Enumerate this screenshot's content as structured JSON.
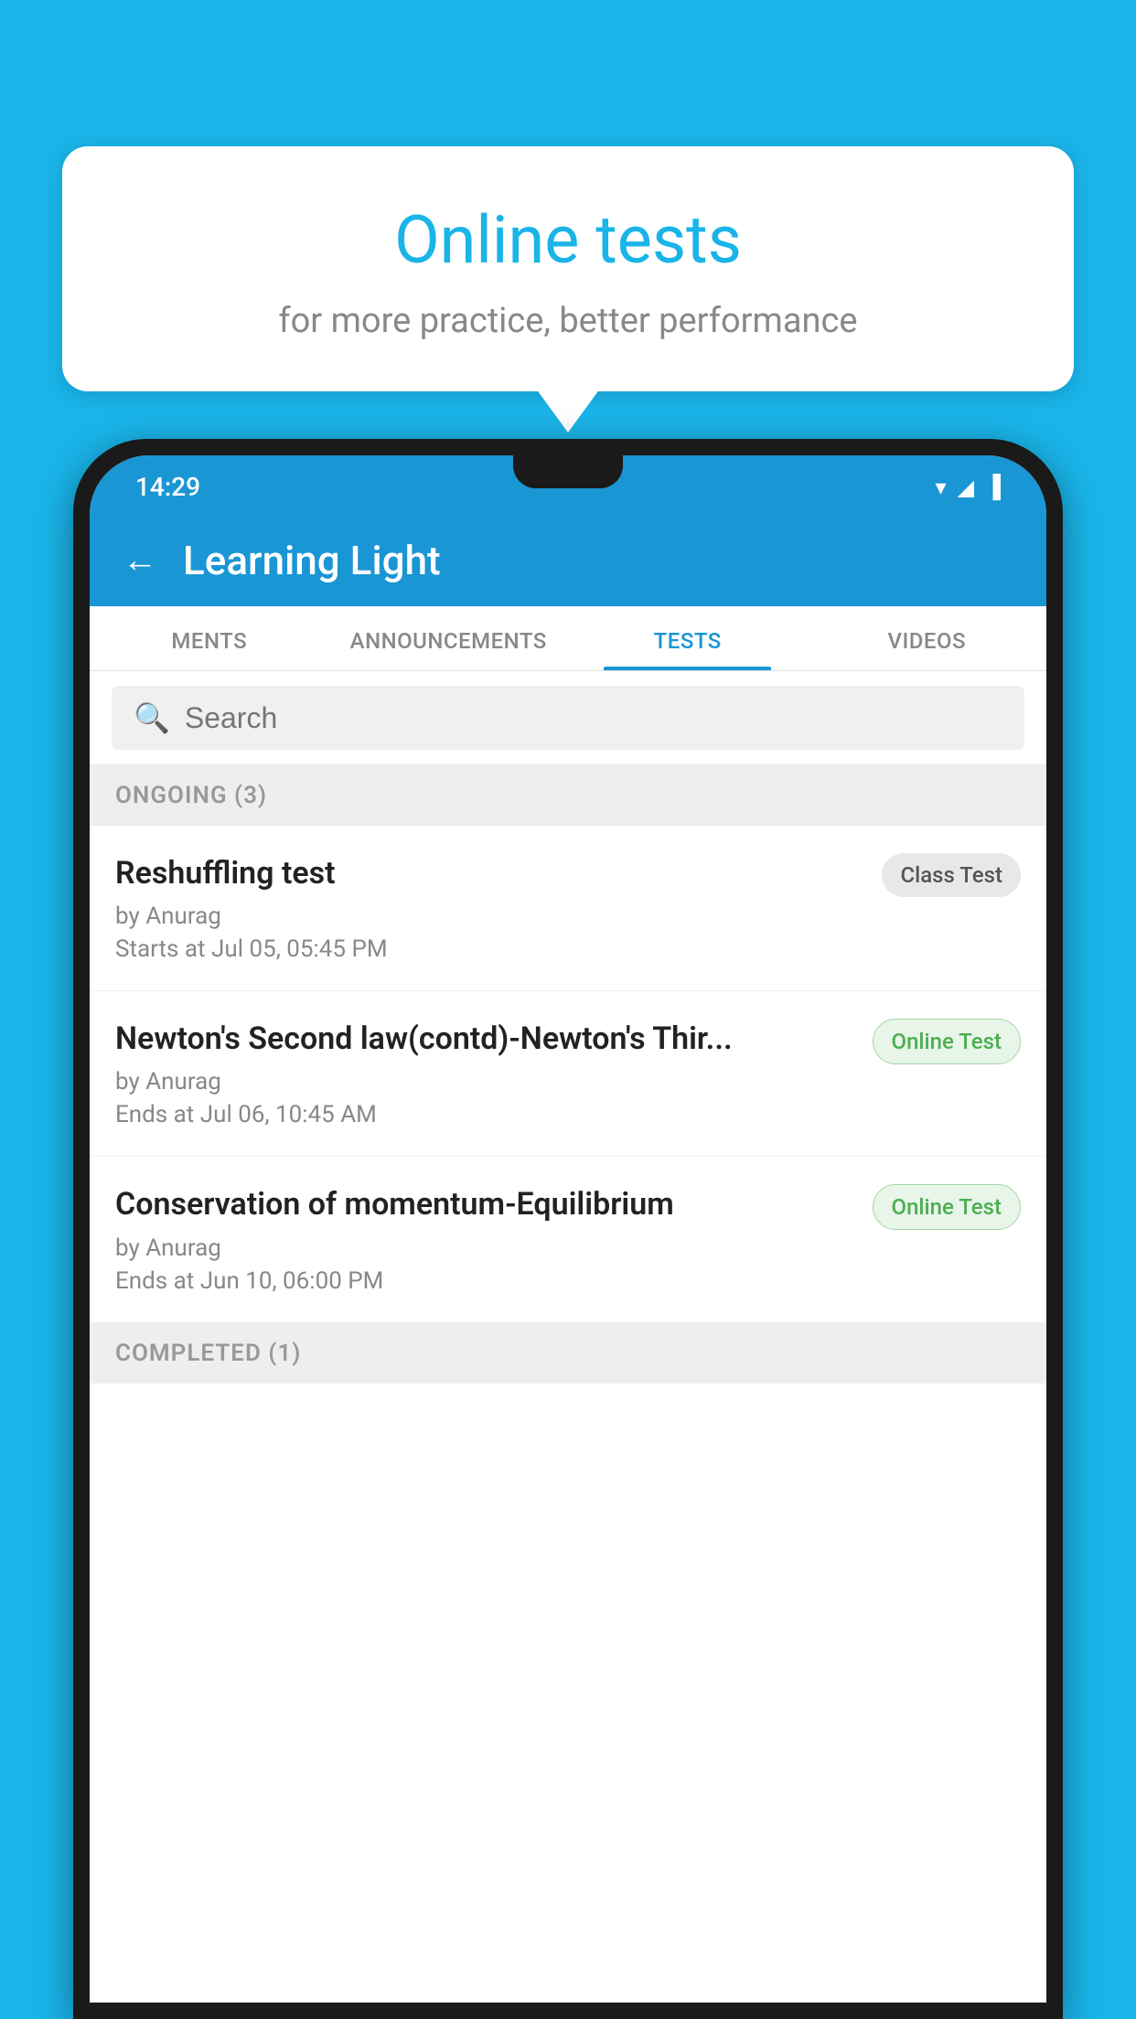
{
  "background_color": "#1ab4e8",
  "bubble": {
    "title": "Online tests",
    "subtitle": "for more practice, better performance"
  },
  "status_bar": {
    "time": "14:29",
    "wifi_icon": "▾",
    "signal_icon": "▲",
    "battery_icon": "▐"
  },
  "app_bar": {
    "back_label": "←",
    "title": "Learning Light"
  },
  "tabs": [
    {
      "label": "MENTS",
      "active": false
    },
    {
      "label": "ANNOUNCEMENTS",
      "active": false
    },
    {
      "label": "TESTS",
      "active": true
    },
    {
      "label": "VIDEOS",
      "active": false
    }
  ],
  "search": {
    "placeholder": "Search"
  },
  "ongoing_section": {
    "label": "ONGOING (3)"
  },
  "tests": [
    {
      "name": "Reshuffling test",
      "by": "by Anurag",
      "time_label": "Starts at",
      "time_value": " Jul 05, 05:45 PM",
      "badge": "Class Test",
      "badge_type": "class"
    },
    {
      "name": "Newton's Second law(contd)-Newton's Thir...",
      "by": "by Anurag",
      "time_label": "Ends at",
      "time_value": " Jul 06, 10:45 AM",
      "badge": "Online Test",
      "badge_type": "online"
    },
    {
      "name": "Conservation of momentum-Equilibrium",
      "by": "by Anurag",
      "time_label": "Ends at",
      "time_value": " Jun 10, 06:00 PM",
      "badge": "Online Test",
      "badge_type": "online"
    }
  ],
  "completed_section": {
    "label": "COMPLETED (1)"
  }
}
